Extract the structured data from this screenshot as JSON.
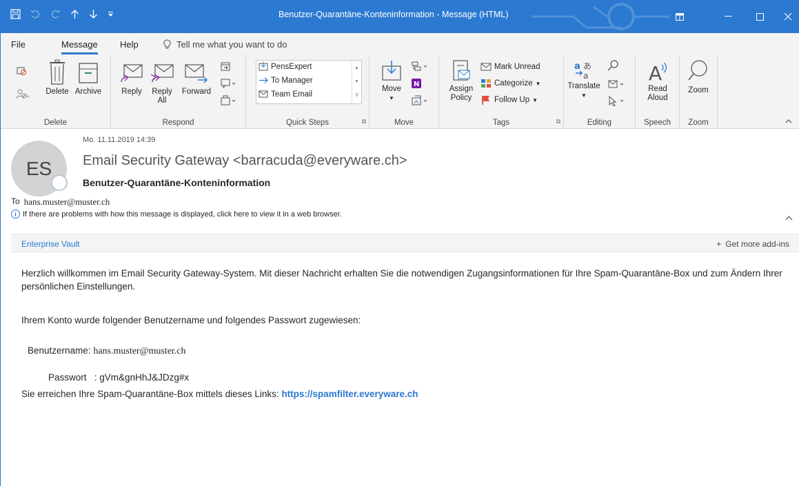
{
  "window": {
    "title": "Benutzer-Quarantäne-Konteninformation  -  Message (HTML)"
  },
  "tabs": [
    {
      "label": "File"
    },
    {
      "label": "Message"
    },
    {
      "label": "Help"
    }
  ],
  "tellme": {
    "label": "Tell me what you want to do"
  },
  "ribbon": {
    "delete_group": {
      "label": "Delete",
      "delete": "Delete",
      "archive": "Archive"
    },
    "respond_group": {
      "label": "Respond",
      "reply": "Reply",
      "reply_all_1": "Reply",
      "reply_all_2": "All",
      "forward": "Forward"
    },
    "quicksteps_group": {
      "label": "Quick Steps",
      "items": [
        "PensExpert",
        "To Manager",
        "Team Email"
      ]
    },
    "move_group": {
      "label": "Move",
      "move": "Move"
    },
    "tags_group": {
      "label": "Tags",
      "assign_1": "Assign",
      "assign_2": "Policy",
      "mark_unread": "Mark Unread",
      "categorize": "Categorize",
      "follow_up": "Follow Up"
    },
    "editing_group": {
      "label": "Editing",
      "translate": "Translate"
    },
    "speech_group": {
      "label": "Speech",
      "read_1": "Read",
      "read_2": "Aloud"
    },
    "zoom_group": {
      "label": "Zoom",
      "zoom": "Zoom"
    }
  },
  "message": {
    "date": "Mo. 11.11.2019 14:39",
    "avatar_initials": "ES",
    "sender": "Email Security Gateway <barracuda@everyware.ch>",
    "subject": "Benutzer-Quarantäne-Konteninformation",
    "to_label": "To",
    "to_address": "hans.muster@muster.ch",
    "info": "If there are problems with how this message is displayed, click here to view it in a web browser."
  },
  "addins": {
    "vault": "Enterprise Vault",
    "get_more": "Get more add-ins",
    "plus": "+"
  },
  "body": {
    "p1": "Herzlich willkommen im Email Security Gateway-System.  Mit dieser Nachricht erhalten Sie die notwendigen Zugangsinformationen für Ihre Spam-Quarantäne-Box und zum Ändern Ihrer persönlichen Einstellungen.",
    "p2": "Ihrem Konto wurde folgender Benutzername und folgendes Passwort zugewiesen:",
    "username_label": "Benutzername: ",
    "username_value": "hans.muster@muster.ch",
    "password_label": "Passwort   : ",
    "password_value": "gVm&gnHhJ&JDzg#x",
    "p3": "Sie erreichen Ihre Spam-Quarantäne-Box mittels dieses Links: ",
    "link": "https://spamfilter.everyware.ch"
  }
}
